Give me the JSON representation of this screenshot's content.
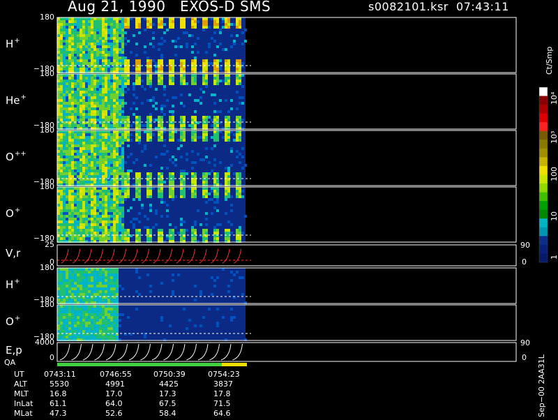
{
  "header": {
    "title": "Aug 21, 1990   EXOS-D SMS",
    "file_time": "s0082101.ksr  07:43:11"
  },
  "panels": [
    {
      "label": "H",
      "superscript": "+",
      "top_tick": "180",
      "bottom_tick": "−180"
    },
    {
      "label": "He",
      "superscript": "+",
      "top_tick": "180",
      "bottom_tick": "−180"
    },
    {
      "label": "O",
      "superscript": "++",
      "top_tick": "180",
      "bottom_tick": "−180"
    },
    {
      "label": "O",
      "superscript": "+",
      "top_tick": "180",
      "bottom_tick": "−180"
    },
    {
      "label": "V,r",
      "superscript": "",
      "top_tick": "25",
      "bottom_tick": "0",
      "right_top": "90",
      "right_bottom": "0"
    },
    {
      "label": "H",
      "superscript": "+",
      "top_tick": "180",
      "bottom_tick": "−180"
    },
    {
      "label": "O",
      "superscript": "+",
      "top_tick": "180",
      "bottom_tick": "−180"
    },
    {
      "label": "E,p",
      "superscript": "",
      "top_tick": "4000",
      "bottom_tick": "0",
      "right_top": "90",
      "right_bottom": "0"
    }
  ],
  "qa_label": "QA",
  "colorbar": {
    "unit": "Ct/Smp",
    "tick_labels": [
      "10⁴",
      "10³",
      "100",
      "10",
      "1"
    ],
    "colors": [
      "#ffffff",
      "#8b0000",
      "#b00000",
      "#e00000",
      "#ff2020",
      "#7a5a00",
      "#8a7a00",
      "#a09000",
      "#c8b400",
      "#f0e000",
      "#c8e600",
      "#90d800",
      "#40c000",
      "#00a000",
      "#008800",
      "#00b4c8",
      "#0096b4",
      "#0a2e8a",
      "#08207a",
      "#061a6a"
    ]
  },
  "footer": {
    "rows": [
      {
        "name": "UT",
        "values": [
          "0743:11",
          "0746:55",
          "0750:39",
          "0754:23"
        ]
      },
      {
        "name": "ALT",
        "values": [
          "5530",
          "4991",
          "4425",
          "3837"
        ]
      },
      {
        "name": "MLT",
        "values": [
          "16.8",
          "17.0",
          "17.3",
          "17.8"
        ]
      },
      {
        "name": "InLat",
        "values": [
          "61.1",
          "64.0",
          "67.5",
          "71.5"
        ]
      },
      {
        "name": "MLat",
        "values": [
          "47.3",
          "52.6",
          "58.4",
          "64.6"
        ]
      }
    ],
    "side_note": "Sep−00  2AA31L"
  },
  "chart_data": {
    "type": "heatmap",
    "title": "Aug 21, 1990   EXOS-D SMS",
    "xlabel": "UT",
    "x": [
      "0743:11",
      "0746:55",
      "0750:39",
      "0754:23"
    ],
    "panels": [
      "H+",
      "He+",
      "O++",
      "O+",
      "V,r",
      "H+",
      "O+",
      "E,p"
    ],
    "ylim_pitch": [
      -180,
      180
    ],
    "ylim_vr": [
      0,
      25
    ],
    "ylim_ep": [
      0,
      4000
    ],
    "colorbar_scale": "log",
    "colorbar_range": [
      1,
      10000
    ],
    "colorbar_unit": "Ct/Smp",
    "data_extent_fraction": 0.38
  }
}
